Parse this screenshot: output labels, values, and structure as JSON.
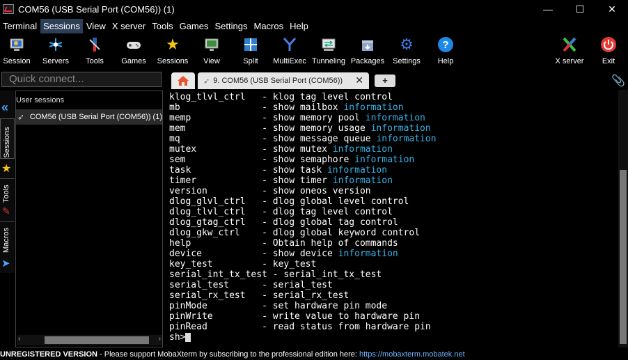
{
  "window": {
    "title": "COM56  (USB Serial Port (COM56)) (1)",
    "controls": [
      "—",
      "☐",
      "✕"
    ]
  },
  "menu": [
    "Terminal",
    "Sessions",
    "View",
    "X server",
    "Tools",
    "Games",
    "Settings",
    "Macros",
    "Help"
  ],
  "menu_active": "Sessions",
  "toolbar": [
    {
      "label": "Session",
      "icon": "session-icon"
    },
    {
      "label": "Servers",
      "icon": "servers-icon"
    },
    {
      "label": "Tools",
      "icon": "tools-icon"
    },
    {
      "label": "Games",
      "icon": "games-icon"
    },
    {
      "label": "Sessions",
      "icon": "star-icon"
    },
    {
      "label": "View",
      "icon": "view-icon"
    },
    {
      "label": "Split",
      "icon": "split-icon"
    },
    {
      "label": "MultiExec",
      "icon": "multiexec-icon"
    },
    {
      "label": "Tunneling",
      "icon": "tunneling-icon"
    },
    {
      "label": "Packages",
      "icon": "packages-icon"
    },
    {
      "label": "Settings",
      "icon": "gear-icon"
    },
    {
      "label": "Help",
      "icon": "help-icon"
    },
    {
      "label": "X server",
      "icon": "xserver-icon"
    },
    {
      "label": "Exit",
      "icon": "power-icon"
    }
  ],
  "quick_connect": {
    "placeholder": "Quick connect..."
  },
  "tabs": {
    "session_tab": "9. COM56  (USB Serial Port (COM56))",
    "close": "✕",
    "add": "+"
  },
  "sidebar": {
    "tabs": [
      "Sessions",
      "Tools",
      "Macros"
    ],
    "header": "User sessions",
    "items": [
      "COM56  (USB Serial Port (COM56)) (1)"
    ]
  },
  "terminal": {
    "lines": [
      {
        "cmd": "klog_tlvl_ctrl   ",
        "desc": "- klog tag level control",
        "info": ""
      },
      {
        "cmd": "mb               ",
        "desc": "- show mailbox ",
        "info": "information"
      },
      {
        "cmd": "memp             ",
        "desc": "- show memory pool ",
        "info": "information"
      },
      {
        "cmd": "mem              ",
        "desc": "- show memory usage ",
        "info": "information"
      },
      {
        "cmd": "mq               ",
        "desc": "- show message queue ",
        "info": "information"
      },
      {
        "cmd": "mutex            ",
        "desc": "- show mutex ",
        "info": "information"
      },
      {
        "cmd": "sem              ",
        "desc": "- show semaphore ",
        "info": "information"
      },
      {
        "cmd": "task             ",
        "desc": "- show task ",
        "info": "information"
      },
      {
        "cmd": "timer            ",
        "desc": "- show timer ",
        "info": "information"
      },
      {
        "cmd": "version          ",
        "desc": "- show oneos version",
        "info": ""
      },
      {
        "cmd": "dlog_glvl_ctrl   ",
        "desc": "- dlog global level control",
        "info": ""
      },
      {
        "cmd": "dlog_tlvl_ctrl   ",
        "desc": "- dlog tag level control",
        "info": ""
      },
      {
        "cmd": "dlog_gtag_ctrl   ",
        "desc": "- dlog global tag control",
        "info": ""
      },
      {
        "cmd": "dlog_gkw_ctrl    ",
        "desc": "- dlog global keyword control",
        "info": ""
      },
      {
        "cmd": "help             ",
        "desc": "- Obtain help of commands",
        "info": ""
      },
      {
        "cmd": "device           ",
        "desc": "- show device ",
        "info": "information"
      },
      {
        "cmd": "key_test         ",
        "desc": "- key_test",
        "info": ""
      },
      {
        "cmd": "serial_int_tx_test ",
        "desc": "- serial_int_tx_test",
        "info": ""
      },
      {
        "cmd": "serial_test      ",
        "desc": "- serial_test",
        "info": ""
      },
      {
        "cmd": "serial_rx_test   ",
        "desc": "- serial_rx_test",
        "info": ""
      },
      {
        "cmd": "pinMode          ",
        "desc": "- set hardware pin mode",
        "info": ""
      },
      {
        "cmd": "pinWrite         ",
        "desc": "- write value to hardware pin",
        "info": ""
      },
      {
        "cmd": "pinRead          ",
        "desc": "- read status from hardware pin",
        "info": ""
      }
    ],
    "prompt": "sh>"
  },
  "status": {
    "edition": "UNREGISTERED VERSION",
    "message": "  -  Please support MobaXterm by subscribing to the professional edition here:  ",
    "link": "https://mobaxterm.mobatek.net"
  },
  "colors": {
    "info": "#38b2e8",
    "menu_active": "#2c3f57",
    "accent": "#4aa3ff"
  }
}
